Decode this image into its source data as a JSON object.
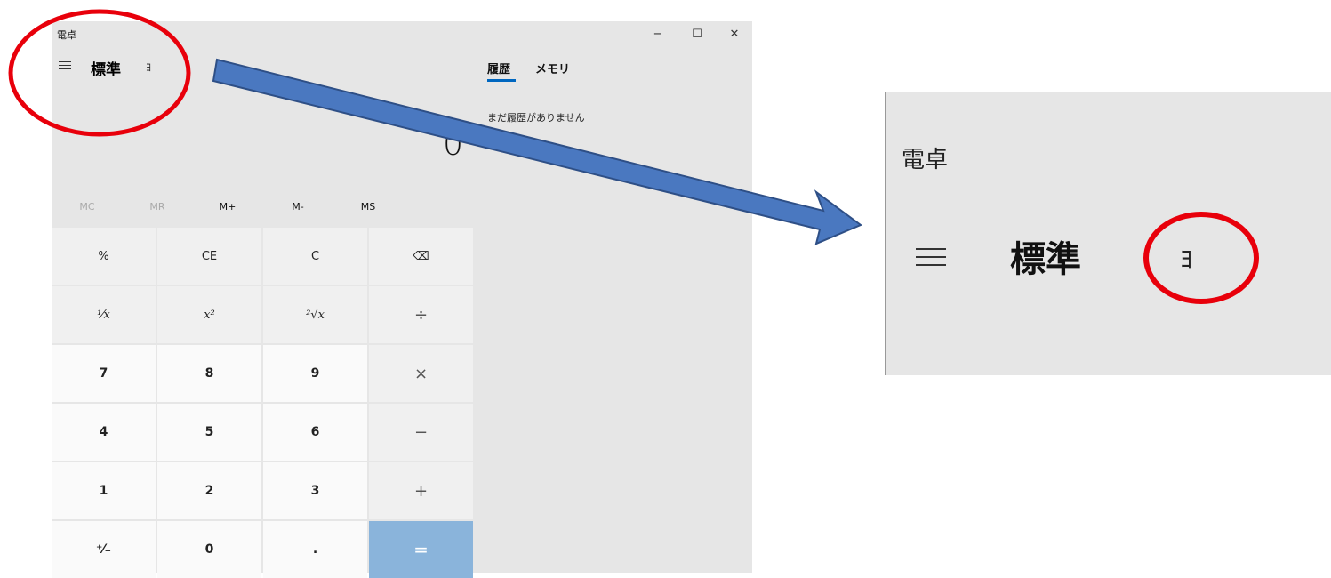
{
  "window": {
    "title": "電卓",
    "minimize_glyph": "−",
    "maximize_glyph": "☐",
    "close_glyph": "✕"
  },
  "header": {
    "mode": "標準",
    "keep_on_top_glyph": "ﾖ"
  },
  "display": {
    "value": "0"
  },
  "memory": {
    "mc": "MC",
    "mr": "MR",
    "mplus": "M+",
    "mminus": "M-",
    "ms": "MS"
  },
  "keys": {
    "percent": "%",
    "ce": "CE",
    "c": "C",
    "backspace": "⌫",
    "reciprocal": "¹⁄x",
    "square": "x²",
    "sqrt": "²√x",
    "divide": "÷",
    "seven": "7",
    "eight": "8",
    "nine": "9",
    "multiply": "×",
    "four": "4",
    "five": "5",
    "six": "6",
    "minus": "−",
    "one": "1",
    "two": "2",
    "three": "3",
    "plus": "+",
    "negate": "⁺⁄₋",
    "zero": "0",
    "decimal": ".",
    "equals": "="
  },
  "history": {
    "tab_history": "履歴",
    "tab_memory": "メモリ",
    "empty_text": "まだ履歴がありません"
  },
  "zoom": {
    "title": "電卓",
    "mode": "標準",
    "keep_on_top_glyph": "ﾖ"
  },
  "annotation": {
    "circle_color": "#e8000b",
    "arrow_color": "#4a78c0"
  }
}
